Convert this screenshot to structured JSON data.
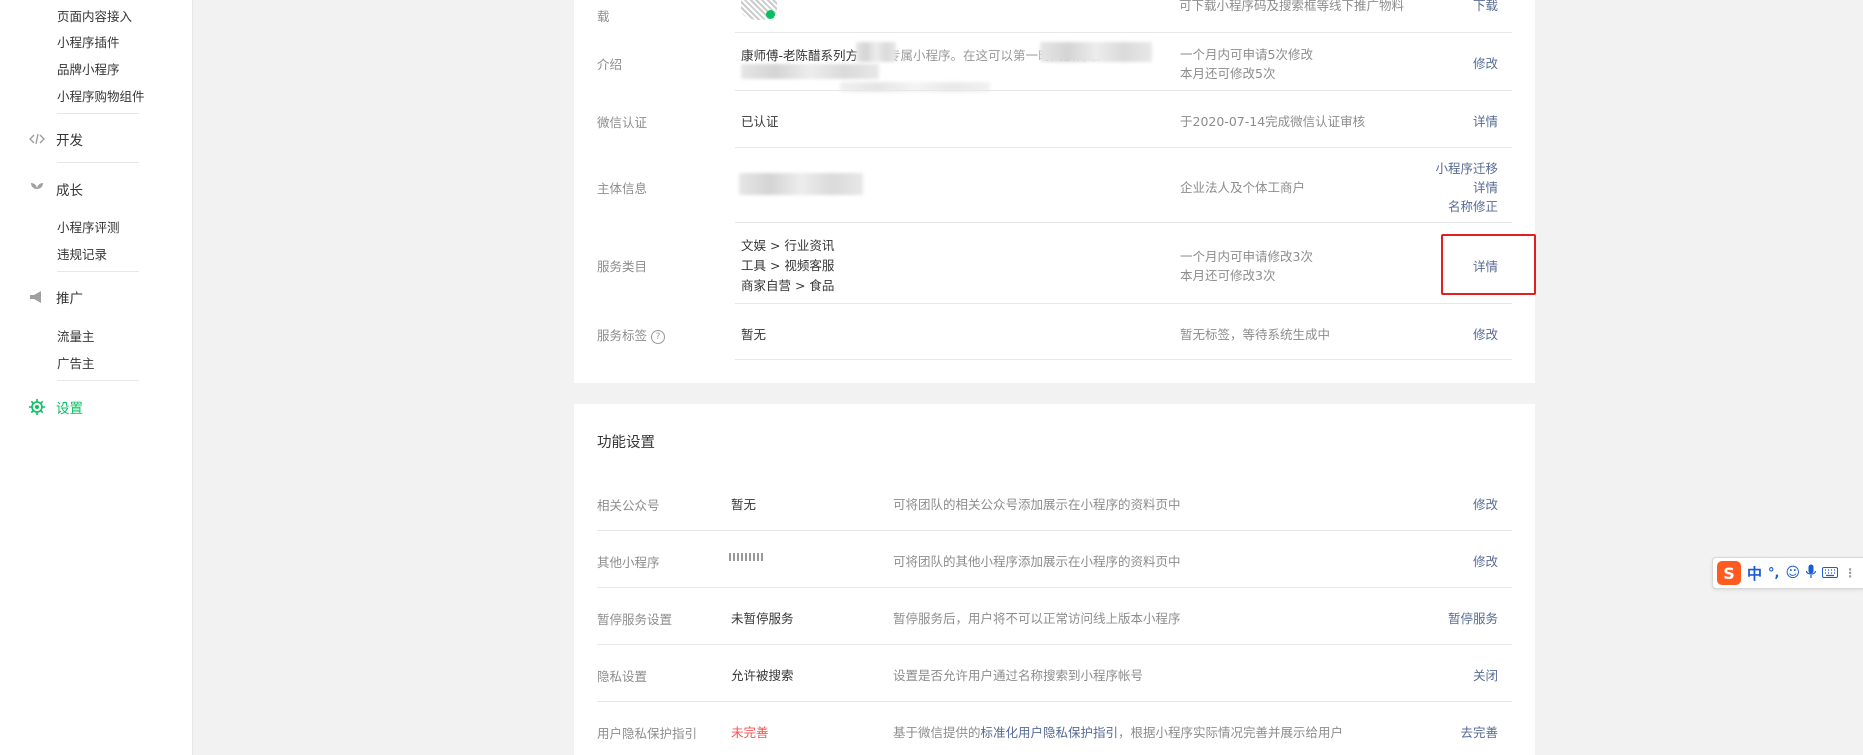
{
  "sidebar": {
    "sub_top": [
      "页面内容接入",
      "小程序插件",
      "品牌小程序",
      "小程序购物组件"
    ],
    "dev_label": "开发",
    "growth_label": "成长",
    "growth_items": [
      "小程序评测",
      "违规记录"
    ],
    "promo_label": "推广",
    "promo_items": [
      "流量主",
      "广告主"
    ],
    "settings_label": "设置",
    "active_color": "#07c160"
  },
  "basic_info": {
    "rows": [
      {
        "label": "载",
        "value": "",
        "desc": "可下载小程序码及搜索框等线下推广物料",
        "action": "下载"
      },
      {
        "label": "介绍",
        "value_line1": "康师傅-老陈醋系列方",
        "value_mid": "专属小程序。在这可以第一时间获得最",
        "desc_line1": "一个月内可申请5次修改",
        "desc_line2": "本月还可修改5次",
        "action": "修改"
      },
      {
        "label": "微信认证",
        "value": "已认证",
        "desc": "于2020-07-14完成微信认证审核",
        "action": "详情"
      },
      {
        "label": "主体信息",
        "value": "",
        "desc": "企业法人及个体工商户",
        "actions": [
          "小程序迁移",
          "详情",
          "名称修正"
        ]
      },
      {
        "label": "服务类目",
        "categories": [
          "文娱 > 行业资讯",
          "工具 > 视频客服",
          "商家自营 > 食品"
        ],
        "desc_line1": "一个月内可申请修改3次",
        "desc_line2": "本月还可修改3次",
        "action": "详情"
      },
      {
        "label": "服务标签",
        "help": "?",
        "value": "暂无",
        "desc": "暂无标签，等待系统生成中",
        "action": "修改"
      }
    ]
  },
  "func_settings": {
    "title": "功能设置",
    "rows": [
      {
        "label": "相关公众号",
        "value": "暂无",
        "desc": "可将团队的相关公众号添加展示在小程序的资料页中",
        "action": "修改"
      },
      {
        "label": "其他小程序",
        "value": "",
        "desc": "可将团队的其他小程序添加展示在小程序的资料页中",
        "action": "修改"
      },
      {
        "label": "暂停服务设置",
        "value": "未暂停服务",
        "desc": "暂停服务后，用户将不可以正常访问线上版本小程序",
        "action": "暂停服务"
      },
      {
        "label": "隐私设置",
        "value": "允许被搜索",
        "desc": "设置是否允许用户通过名称搜索到小程序帐号",
        "action": "关闭"
      },
      {
        "label": "用户隐私保护指引",
        "value": "未完善",
        "desc_prefix": "基于微信提供的",
        "desc_link": "标准化用户隐私保护指引",
        "desc_suffix": "，根据小程序实际情况完善并展示给用户",
        "action": "去完善"
      }
    ]
  },
  "ime": {
    "logo": "S",
    "lang": "中"
  },
  "colors": {
    "link": "#576b95",
    "warn": "#fa5151",
    "highlight_box": "#e02020"
  }
}
